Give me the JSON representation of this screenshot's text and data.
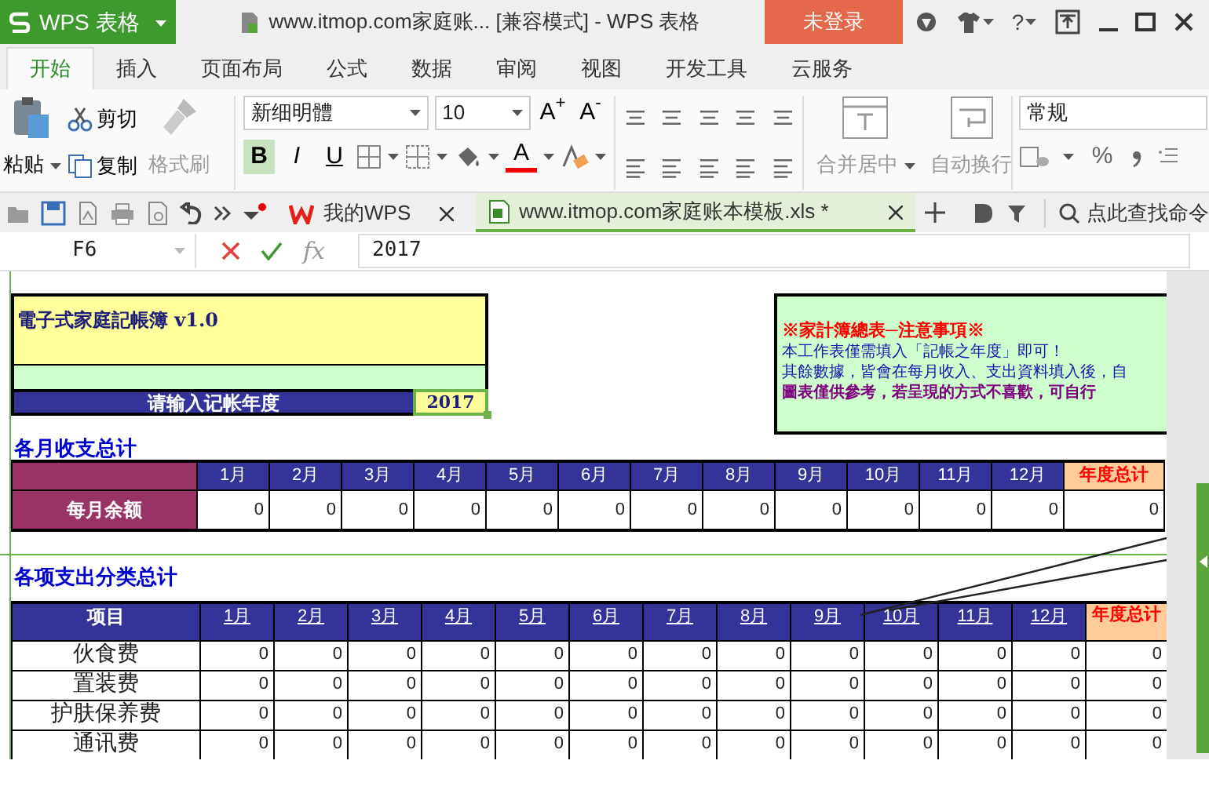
{
  "app": {
    "logo": "WPS 表格",
    "title": "www.itmop.com家庭账... [兼容模式] - WPS 表格",
    "login": "未登录",
    "help": "?"
  },
  "ribbon_tabs": [
    {
      "label": "开始",
      "selected": true
    },
    {
      "label": "插入",
      "selected": false
    },
    {
      "label": "页面布局",
      "selected": false
    },
    {
      "label": "公式",
      "selected": false
    },
    {
      "label": "数据",
      "selected": false
    },
    {
      "label": "审阅",
      "selected": false
    },
    {
      "label": "视图",
      "selected": false
    },
    {
      "label": "开发工具",
      "selected": false
    },
    {
      "label": "云服务",
      "selected": false
    }
  ],
  "ribbon": {
    "paste": {
      "label": "粘贴",
      "disabled": false
    },
    "cut": {
      "label": "剪切",
      "disabled": false
    },
    "copy": {
      "label": "复制",
      "disabled": false
    },
    "format_painter": {
      "label": "格式刷",
      "disabled": true
    },
    "font": "新细明體",
    "font_size": "10",
    "grow": "A$^{+}$",
    "shrink": "A$^{-}$",
    "bold": {
      "label": "B",
      "on": true
    },
    "italic": {
      "label": "I",
      "on": false
    },
    "underline": {
      "label": "U",
      "on": false
    },
    "font_color": "A",
    "merge_center": {
      "label": "合并居中",
      "disabled": true
    },
    "wrap_text": {
      "label": "自动换行",
      "disabled": true
    },
    "number_format": "常规",
    "percent": "%"
  },
  "doc_tabs": [
    {
      "label": "我的WPS",
      "selected": false
    },
    {
      "label": "www.itmop.com家庭账本模板.xls *",
      "selected": true
    }
  ],
  "search_command": "点此查找命令",
  "formula_bar": {
    "cell_ref": "F6",
    "fx": "fx",
    "formula": "2017"
  },
  "sheet": {
    "title": "電子式家庭記帳簿 v1.0",
    "year_label": "请输入记帐年度",
    "year_value": {
      "text": "2017",
      "selected": true
    },
    "note": {
      "heading": "※家計簿總表─注意事項※",
      "lines": [
        {
          "text": "本工作表僅需填入「記帳之年度」即可！",
          "kind": "info"
        },
        {
          "text": "其餘數據，皆會在每月收入、支出資料填入後，自",
          "kind": "info"
        },
        {
          "text": "圖表僅供參考，若呈現的方式不喜歡，可自行",
          "kind": "emphasis"
        }
      ]
    },
    "monthly": {
      "heading": "各月收支总计",
      "columns": [
        {
          "label": "1月",
          "kind": "month"
        },
        {
          "label": "2月",
          "kind": "month"
        },
        {
          "label": "3月",
          "kind": "month"
        },
        {
          "label": "4月",
          "kind": "month"
        },
        {
          "label": "5月",
          "kind": "month"
        },
        {
          "label": "6月",
          "kind": "month"
        },
        {
          "label": "7月",
          "kind": "month"
        },
        {
          "label": "8月",
          "kind": "month"
        },
        {
          "label": "9月",
          "kind": "month"
        },
        {
          "label": "10月",
          "kind": "month"
        },
        {
          "label": "11月",
          "kind": "month"
        },
        {
          "label": "12月",
          "kind": "month"
        },
        {
          "label": "年度总计",
          "kind": "total"
        }
      ],
      "rows": [
        {
          "label": "每月余额",
          "values": [
            "0",
            "0",
            "0",
            "0",
            "0",
            "0",
            "0",
            "0",
            "0",
            "0",
            "0",
            "0",
            "0"
          ]
        }
      ]
    },
    "categories": {
      "heading": "各项支出分类总计",
      "corner": "项目",
      "columns": [
        {
          "label": "1月",
          "kind": "month"
        },
        {
          "label": "2月",
          "kind": "month"
        },
        {
          "label": "3月",
          "kind": "month"
        },
        {
          "label": "4月",
          "kind": "month"
        },
        {
          "label": "5月",
          "kind": "month"
        },
        {
          "label": "6月",
          "kind": "month"
        },
        {
          "label": "7月",
          "kind": "month"
        },
        {
          "label": "8月",
          "kind": "month"
        },
        {
          "label": "9月",
          "kind": "month"
        },
        {
          "label": "10月",
          "kind": "month"
        },
        {
          "label": "11月",
          "kind": "month"
        },
        {
          "label": "12月",
          "kind": "month"
        },
        {
          "label": "年度总计",
          "kind": "total"
        }
      ],
      "rows": [
        {
          "label": "伙食费",
          "values": [
            "0",
            "0",
            "0",
            "0",
            "0",
            "0",
            "0",
            "0",
            "0",
            "0",
            "0",
            "0",
            "0"
          ]
        },
        {
          "label": "置装费",
          "values": [
            "0",
            "0",
            "0",
            "0",
            "0",
            "0",
            "0",
            "0",
            "0",
            "0",
            "0",
            "0",
            "0"
          ]
        },
        {
          "label": "护肤保养费",
          "values": [
            "0",
            "0",
            "0",
            "0",
            "0",
            "0",
            "0",
            "0",
            "0",
            "0",
            "0",
            "0",
            "0"
          ]
        },
        {
          "label": "通讯费",
          "values": [
            "0",
            "0",
            "0",
            "0",
            "0",
            "0",
            "0",
            "0",
            "0",
            "0",
            "0",
            "0",
            "0"
          ]
        }
      ]
    }
  }
}
